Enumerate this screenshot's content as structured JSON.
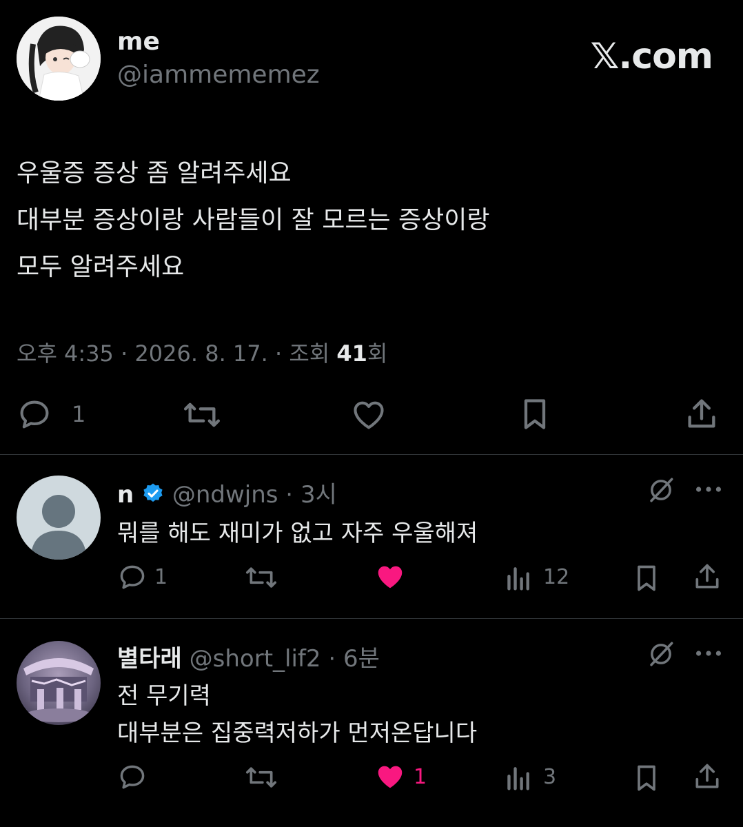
{
  "brand": "𝕏.com",
  "tweet": {
    "name": "me",
    "handle": "@iammememez",
    "lines": [
      "우울증 증상 좀 알려주세요",
      "대부분 증상이랑 사람들이 잘 모르는 증상이랑",
      "모두 알려주세요"
    ],
    "time": "오후 4:35",
    "date": "2026. 8. 17.",
    "views_label": "조회",
    "views_count": "41",
    "views_suffix": "회",
    "reply_count": "1"
  },
  "replies": [
    {
      "name": "n",
      "handle": "@ndwjns",
      "time": "3시",
      "lines": [
        "뭐를 해도 재미가 없고 자주 우울해져"
      ],
      "reply_count": "1",
      "like_count": "",
      "view_count": "12",
      "verified": true
    },
    {
      "name": "별타래",
      "handle": "@short_lif2",
      "time": "6분",
      "lines": [
        "전 무기력",
        "대부분은 집중력저하가 먼저온답니다"
      ],
      "reply_count": "",
      "like_count": "1",
      "view_count": "3",
      "verified": false
    }
  ],
  "colors": {
    "background": "#000000",
    "text": "#e7e9ea",
    "muted": "#71767b",
    "like": "#f91880",
    "verified": "#1d9bf0",
    "divider": "#2f3336"
  },
  "icons": [
    "reply-icon",
    "retweet-icon",
    "like-icon",
    "bookmark-icon",
    "share-icon",
    "views-icon",
    "grok-icon",
    "more-icon",
    "verified-badge-icon"
  ]
}
